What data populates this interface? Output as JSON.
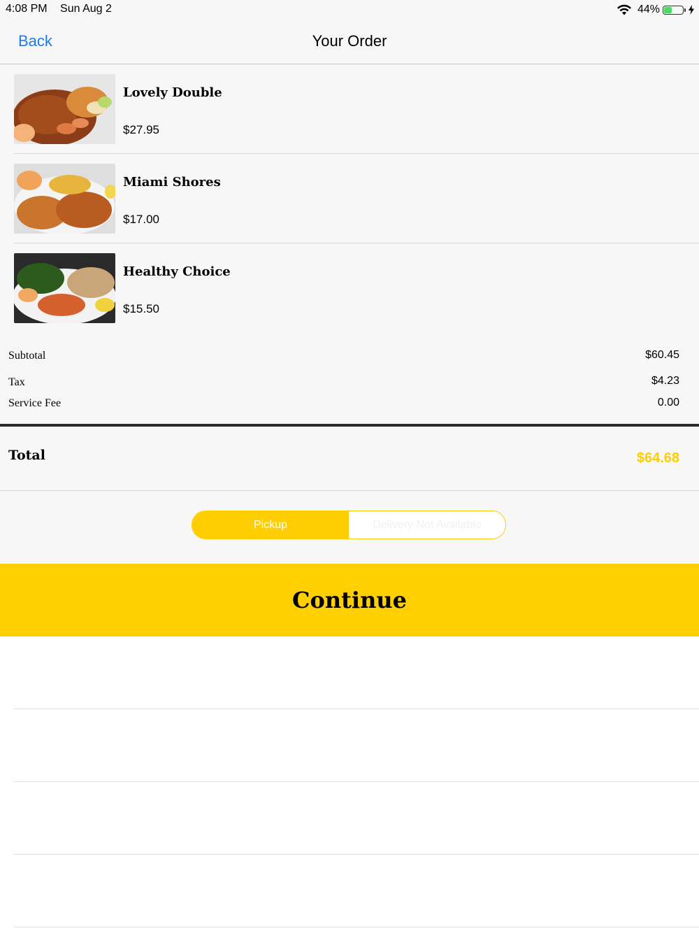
{
  "status": {
    "time": "4:08 PM",
    "date": "Sun Aug 2",
    "battery_pct": "44%",
    "battery_level": 0.44
  },
  "nav": {
    "back_label": "Back",
    "title": "Your Order"
  },
  "items": [
    {
      "name": "Lovely Double",
      "price": "$27.95"
    },
    {
      "name": "Miami Shores",
      "price": "$17.00"
    },
    {
      "name": "Healthy Choice",
      "price": "$15.50"
    }
  ],
  "summary": {
    "subtotal_label": "Subtotal",
    "subtotal_value": "$60.45",
    "tax_label": "Tax",
    "tax_value": "$4.23",
    "service_fee_label": "Service Fee",
    "service_fee_value": "0.00",
    "total_label": "Total",
    "total_value": "$64.68"
  },
  "mode": {
    "pickup_label": "Pickup",
    "delivery_label": "Delivery Not Available",
    "selected": "Pickup"
  },
  "continue_label": "Continue",
  "colors": {
    "accent": "#ffce00",
    "link": "#1a7cf0"
  }
}
